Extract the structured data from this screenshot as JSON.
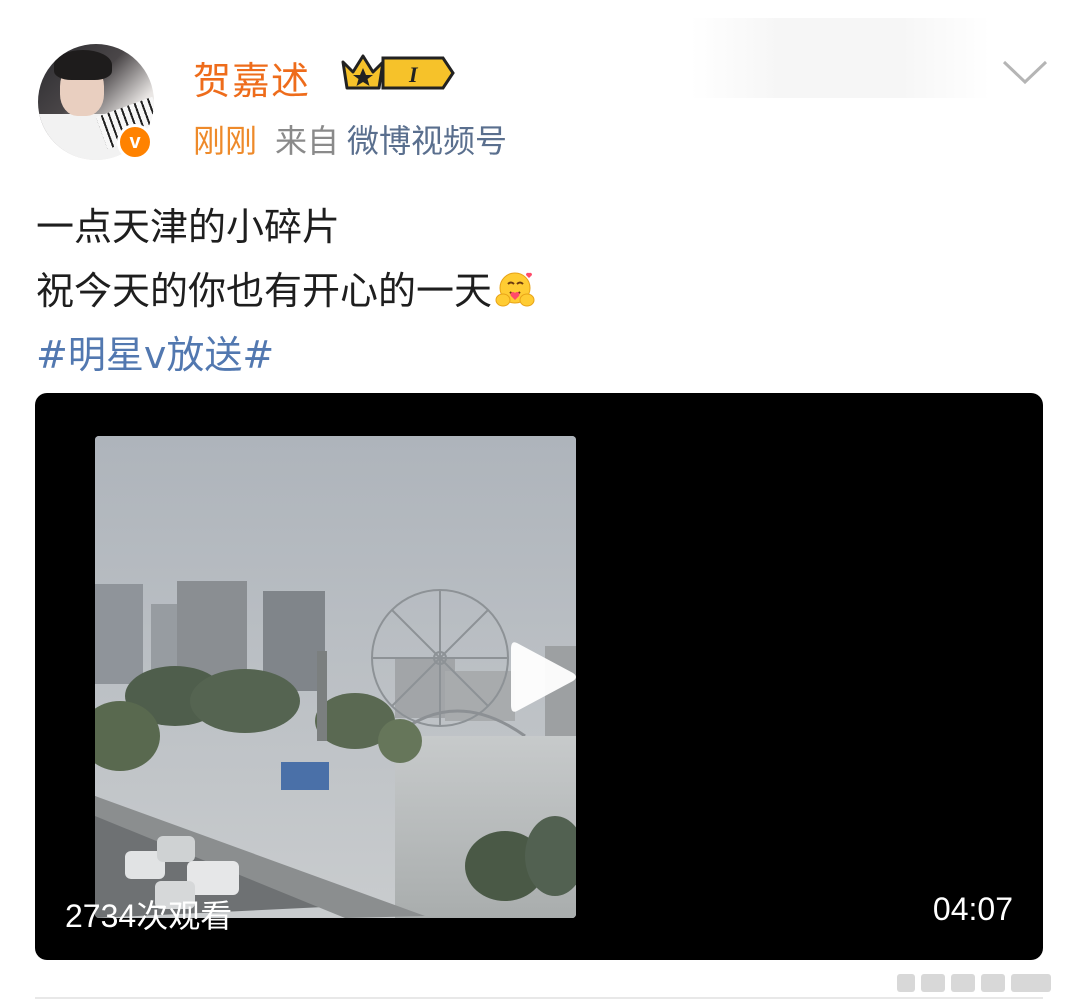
{
  "post": {
    "user": {
      "name": "贺嘉述",
      "avatar_icon": "avatar-photo",
      "verified_badge": "v",
      "vip_level": "I"
    },
    "meta": {
      "time": "刚刚",
      "from_label": "来自",
      "source": "微博视频号"
    },
    "content": {
      "line1": "一点天津的小碎片",
      "line2": "祝今天的你也有开心的一天",
      "emoji_icon": "hug-emoji",
      "hashtag": "#明星v放送#"
    },
    "video": {
      "views": "2734次观看",
      "duration": "04:07"
    }
  },
  "colors": {
    "username": "#ee6c1b",
    "time": "#ee8a2a",
    "hashtag": "#5278b0",
    "verify_badge": "#ff8200",
    "video_bg": "#000000"
  }
}
